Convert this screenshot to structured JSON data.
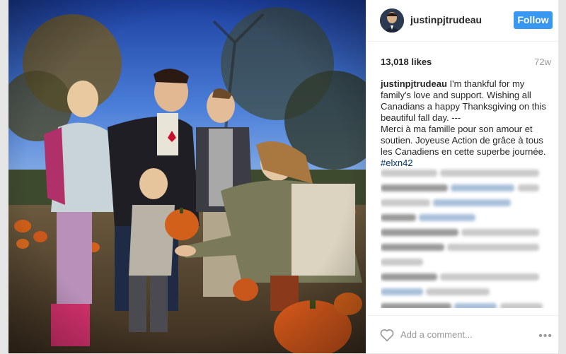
{
  "post": {
    "username": "justinpjtrudeau",
    "follow_label": "Follow",
    "likes": "13,018 likes",
    "age": "72w",
    "caption_user": "justinpjtrudeau",
    "caption_en": "I'm thankful for my family's love and support. Wishing all Canadians a happy Thanksgiving on this beautiful fall day. ---",
    "caption_fr": "Merci à ma famille pour son amour et soutien. Joyeuse Action de grâce à tous les Canadiens en cette superbe journée.",
    "hashtag": "#elxn42",
    "add_comment_placeholder": "Add a comment...",
    "more_label": "•••"
  },
  "icons": {
    "like": "heart-outline-icon",
    "options": "more-options-icon"
  },
  "colors": {
    "follow_button": "#3897f0",
    "hashtag": "#003569",
    "secondary_text": "#999999"
  }
}
